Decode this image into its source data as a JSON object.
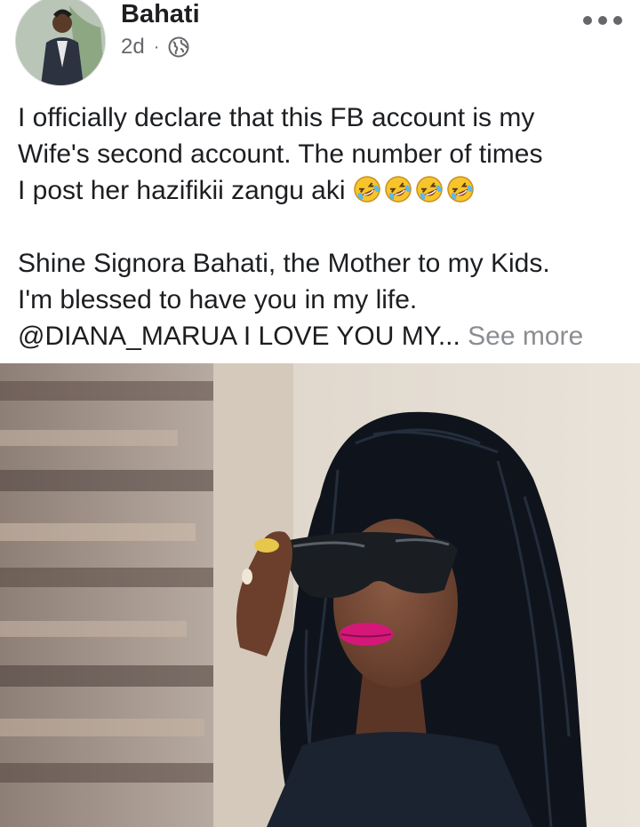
{
  "post": {
    "author": "Bahati",
    "time": "2d",
    "separator": "·",
    "privacy_icon": "globe-icon",
    "more_icon": "more-options-icon",
    "lines": [
      "I officially declare that this FB  account is my",
      "Wife's second account. The number of times",
      "I post her hazifikii zangu aki"
    ],
    "emoji_count": 4,
    "emoji_icon": "rolling-on-floor-laughing-icon",
    "lines2": [
      "Shine Signora Bahati, the Mother to my Kids.",
      "I'm blessed to have you in my life."
    ],
    "last_line": "@DIANA_MARUA I LOVE YOU MY...",
    "see_more": "See more"
  },
  "colors": {
    "text": "#1c1e21",
    "secondary": "#65676b",
    "see_more": "#8a8d91",
    "lipstick": "#d6177a"
  }
}
